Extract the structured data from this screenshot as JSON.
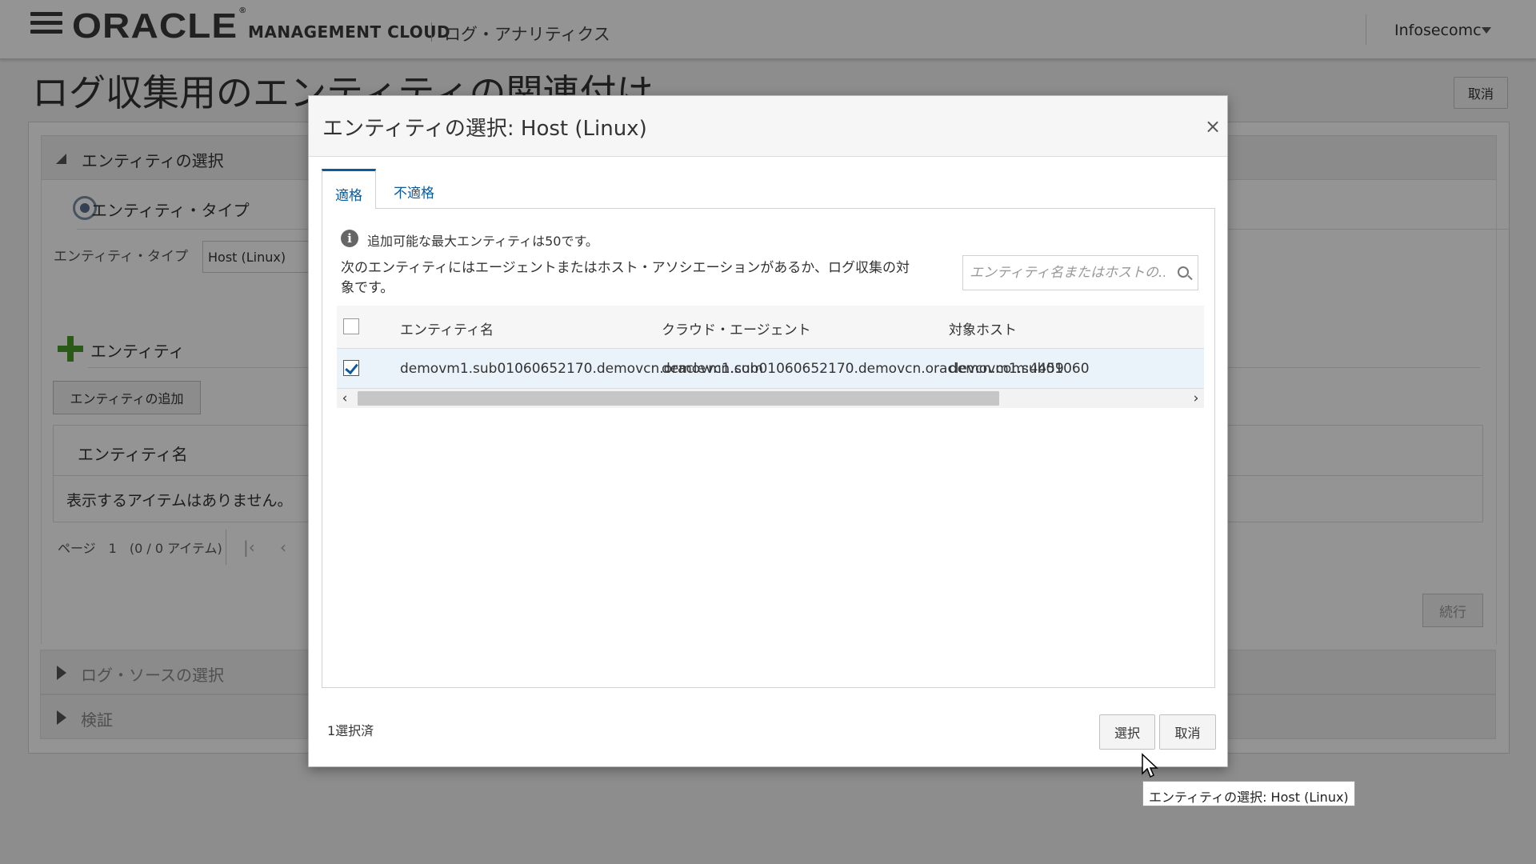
{
  "header": {
    "logo": "ORACLE",
    "logo_mark": "®",
    "product": "MANAGEMENT CLOUD",
    "subproduct": "ログ・アナリティクス",
    "user": "Infosecomc"
  },
  "page": {
    "title": "ログ収集用のエンティティの関連付け",
    "cancel_label": "取消",
    "sections": {
      "entity_select": "エンティティの選択",
      "entity_type": "エンティティ・タイプ",
      "entity_type_label": "エンティティ・タイプ",
      "entity_type_value": "Host (Linux)",
      "entities": "エンティティ",
      "add_entity": "エンティティの追加",
      "table_header": "エンティティ名",
      "empty_message": "表示するアイテムはありません。",
      "pager": "ページ　1　(0 / 0 アイテム)",
      "continue_label": "続行",
      "log_source": "ログ・ソースの選択",
      "validate": "検証"
    }
  },
  "dialog": {
    "title": "エンティティの選択: Host (Linux)",
    "close_glyph": "×",
    "tabs": [
      {
        "label": "適格",
        "active": true
      },
      {
        "label": "不適格",
        "active": false
      }
    ],
    "info_glyph": "i",
    "info_text": "追加可能な最大エンティティは50です。",
    "description": "次のエンティティにはエージェントまたはホスト・アソシエーションがあるか、ログ収集の対象です。",
    "search_placeholder": "エンティティ名またはホストの...",
    "columns": [
      "エンティティ名",
      "クラウド・エージェント",
      "対象ホスト"
    ],
    "rows": [
      {
        "checked": true,
        "entity_name": "demovm1.sub01060652170.demovcn.oraclevcn.com",
        "cloud_agent": "demovm1.sub01060652170.demovcn.oraclevcn.com:4459",
        "target_host": "demovm1.sub01060"
      }
    ],
    "scroll_left": "‹",
    "scroll_right": "›",
    "selected_count": "1選択済",
    "select_label": "選択",
    "cancel_label": "取消"
  },
  "tooltip": "エンティティの選択: Host (Linux)",
  "colors": {
    "accent": "#0a5aa0",
    "selected_row": "#eaf2fa",
    "plus_green": "#4a9a2a"
  }
}
